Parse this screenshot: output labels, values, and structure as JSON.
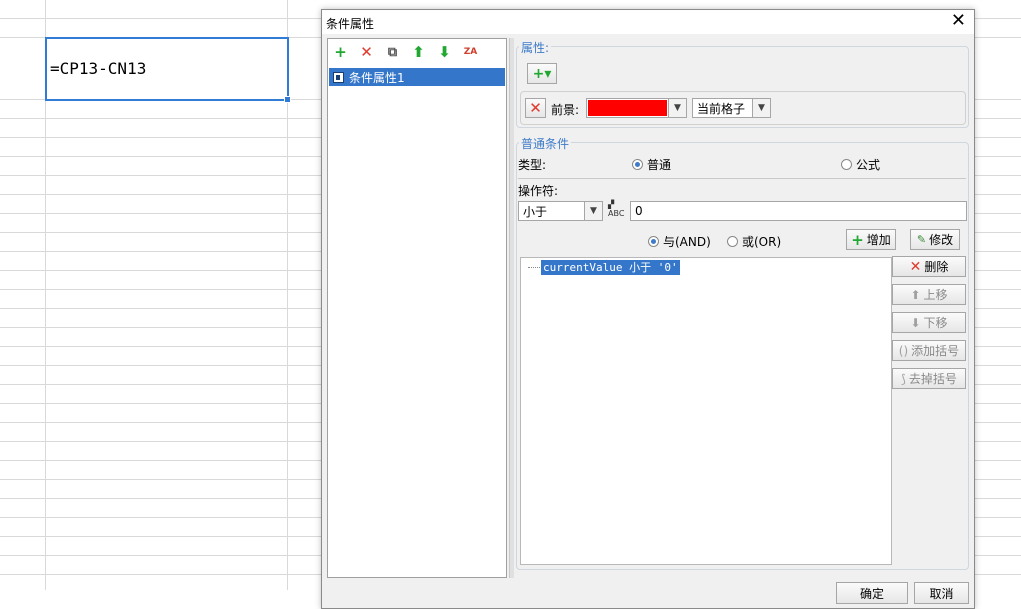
{
  "sheet": {
    "cell_formula": "=CP13-CN13"
  },
  "dialog": {
    "title": "条件属性",
    "close": "✕",
    "toolbar": {
      "add": "+",
      "remove": "✕",
      "copy": "⧉",
      "up": "⬆",
      "down": "⬇",
      "sort": "ZA"
    },
    "tree": {
      "items": [
        "条件属性1"
      ]
    },
    "attributes": {
      "group_title": "属性:",
      "add_button": "+▾",
      "foreground_label": "前景:",
      "foreground_color": "#ff0000",
      "scope_select": "当前格子"
    },
    "condition": {
      "group_title": "普通条件",
      "type_label": "类型:",
      "type_normal": "普通",
      "type_formula": "公式",
      "operator_label": "操作符:",
      "operator_value": "小于",
      "value": "0",
      "and_label": "与(AND)",
      "or_label": "或(OR)",
      "add_button": "增加",
      "modify_button": "修改",
      "conditions": [
        "currentValue 小于 '0'"
      ],
      "delete_button": "删除",
      "move_up_button": "上移",
      "move_down_button": "下移",
      "add_bracket_button": "添加括号",
      "remove_bracket_button": "去掉括号"
    },
    "footer": {
      "ok": "确定",
      "cancel": "取消"
    }
  }
}
